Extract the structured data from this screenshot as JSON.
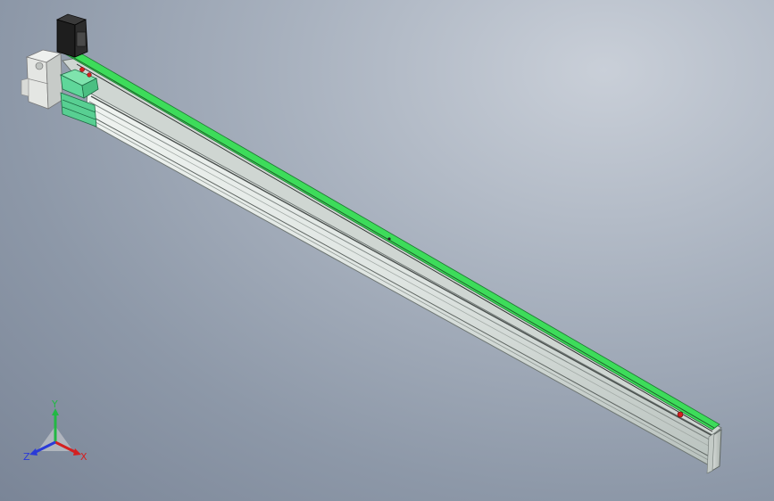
{
  "view": {
    "background_colors": [
      "#c9cfd8",
      "#aab3c0",
      "#7a8597"
    ],
    "model_colors": {
      "rail_body": "#dfe5e2",
      "rail_shadow": "#aeb6b2",
      "guide_strip": "#3ddc5a",
      "motor_body": "#1e1e1e",
      "carriage": "#5fd79a",
      "marker": "#d22020"
    }
  },
  "triad": {
    "x_label": "X",
    "y_label": "Y",
    "z_label": "Z",
    "x_color": "#d42020",
    "y_color": "#22b844",
    "z_color": "#2a3ad8"
  }
}
